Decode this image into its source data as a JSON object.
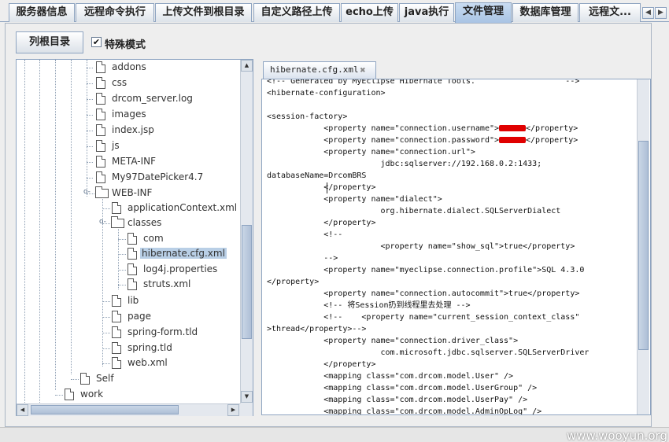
{
  "tabs": [
    {
      "label": "服务器信息",
      "active": false
    },
    {
      "label": "远程命令执行",
      "active": false
    },
    {
      "label": "上传文件到根目录",
      "active": false
    },
    {
      "label": "自定义路径上传",
      "active": false
    },
    {
      "label": "echo上传",
      "active": false
    },
    {
      "label": "java执行",
      "active": false
    },
    {
      "label": "文件管理",
      "active": true
    },
    {
      "label": "数据库管理",
      "active": false
    },
    {
      "label": "远程文...",
      "active": false
    }
  ],
  "toolbar": {
    "list_root_button": "列根目录",
    "special_mode_label": "特殊模式",
    "special_mode_checked": true
  },
  "tree": [
    {
      "label": "addons",
      "type": "file"
    },
    {
      "label": "css",
      "type": "file"
    },
    {
      "label": "drcom_server.log",
      "type": "file"
    },
    {
      "label": "images",
      "type": "file"
    },
    {
      "label": "index.jsp",
      "type": "file"
    },
    {
      "label": "js",
      "type": "file"
    },
    {
      "label": "META-INF",
      "type": "file"
    },
    {
      "label": "My97DatePicker4.7",
      "type": "file"
    },
    {
      "label": "WEB-INF",
      "type": "folder-open"
    },
    {
      "label": "applicationContext.xml",
      "type": "file"
    },
    {
      "label": "classes",
      "type": "folder-open"
    },
    {
      "label": "com",
      "type": "file"
    },
    {
      "label": "hibernate.cfg.xml",
      "type": "file",
      "selected": true
    },
    {
      "label": "log4j.properties",
      "type": "file"
    },
    {
      "label": "struts.xml",
      "type": "file"
    },
    {
      "label": "lib",
      "type": "file"
    },
    {
      "label": "page",
      "type": "file"
    },
    {
      "label": "spring-form.tld",
      "type": "file"
    },
    {
      "label": "spring.tld",
      "type": "file"
    },
    {
      "label": "web.xml",
      "type": "file"
    },
    {
      "label": "Self",
      "type": "file"
    },
    {
      "label": "work",
      "type": "file"
    }
  ],
  "editor": {
    "tab_title": "hibernate.cfg.xml",
    "lines": [
      "<!-- Generated by MyEclipse Hibernate Tools.                   -->",
      "<hibernate-configuration>",
      "",
      "<session-factory>",
      "            <property name=\"connection.username\">",
      "            <property name=\"connection.password\">",
      "            <property name=\"connection.url\">",
      "                        jdbc:sqlserver://192.168.0.2:1433;",
      "databaseName=DrcomBRS",
      "            </property>",
      "            <property name=\"dialect\">",
      "                        org.hibernate.dialect.SQLServerDialect",
      "            </property>",
      "            <!--",
      "                        <property name=\"show_sql\">true</property>",
      "            -->",
      "            <property name=\"myeclipse.connection.profile\">SQL 4.3.0",
      "</property>",
      "            <property name=\"connection.autocommit\">true</property>",
      "            <!-- 将Session扔到线程里去处理 -->",
      "            <!--    <property name=\"current_session_context_class\"",
      ">thread</property>-->",
      "            <property name=\"connection.driver_class\">",
      "                        com.microsoft.jdbc.sqlserver.SQLServerDriver",
      "            </property>",
      "            <mapping class=\"com.drcom.model.User\" />",
      "            <mapping class=\"com.drcom.model.UserGroup\" />",
      "            <mapping class=\"com.drcom.model.UserPay\" />",
      "            <mapping class=\"com.drcom.model.AdminOpLog\" />"
    ],
    "redacted_suffix": "</property>"
  },
  "watermark": "www.wooyun.org",
  "colors": {
    "accent": "#8ea4c1",
    "active_tab": "#b5cde9",
    "selection": "#b9cfe6",
    "redaction": "#e00000"
  }
}
